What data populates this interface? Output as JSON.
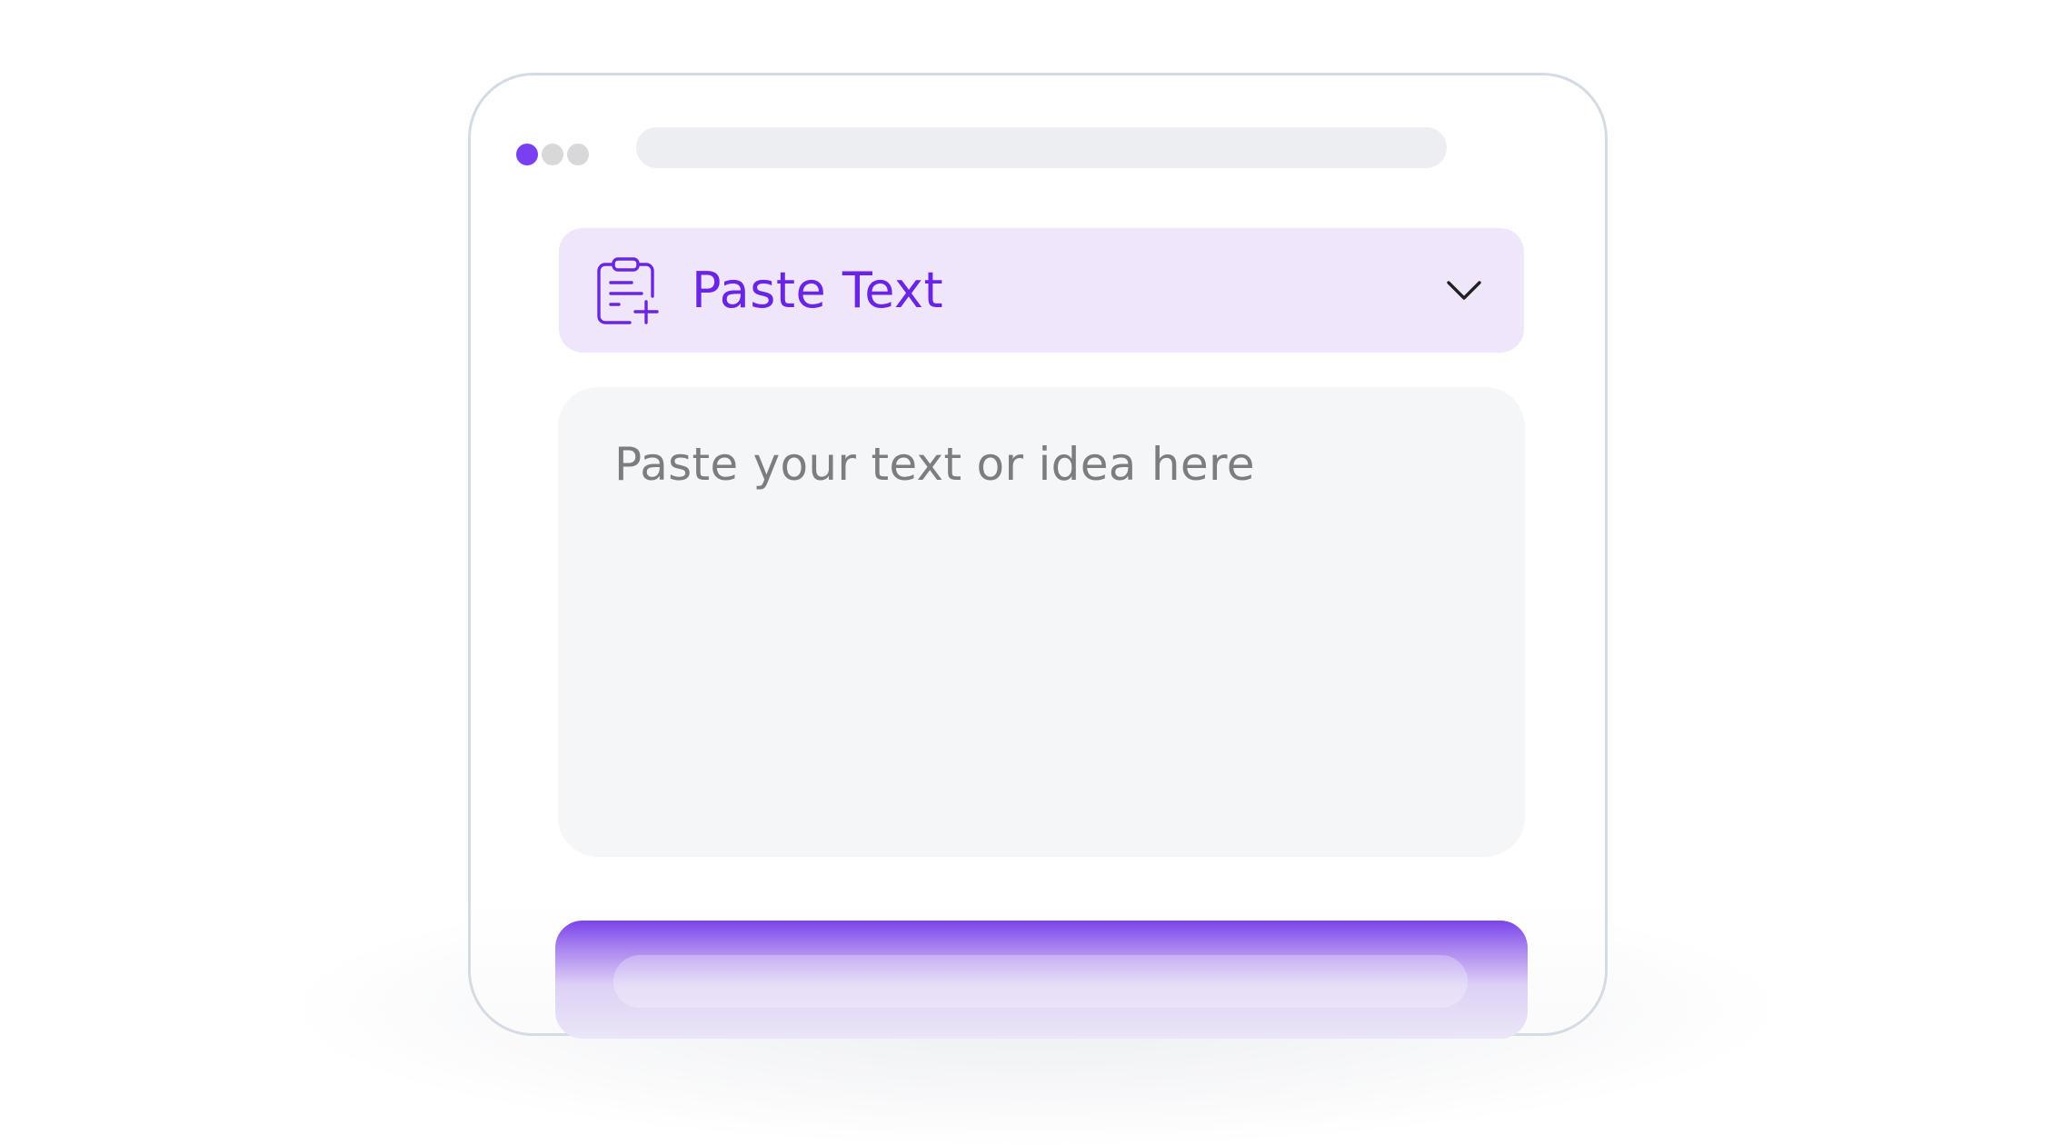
{
  "window": {
    "traffic_lights": [
      "active",
      "inactive",
      "inactive"
    ],
    "address_bar": ""
  },
  "paste_section": {
    "title": "Paste Text",
    "icon": "clipboard-add-icon",
    "toggle_icon": "chevron-down-icon",
    "accent_color": "#6a24e6",
    "background_color": "#efe6fb"
  },
  "text_input": {
    "placeholder": "Paste your text or idea here",
    "value": ""
  },
  "primary_action": {
    "label": "",
    "color": "#7b44ea"
  }
}
